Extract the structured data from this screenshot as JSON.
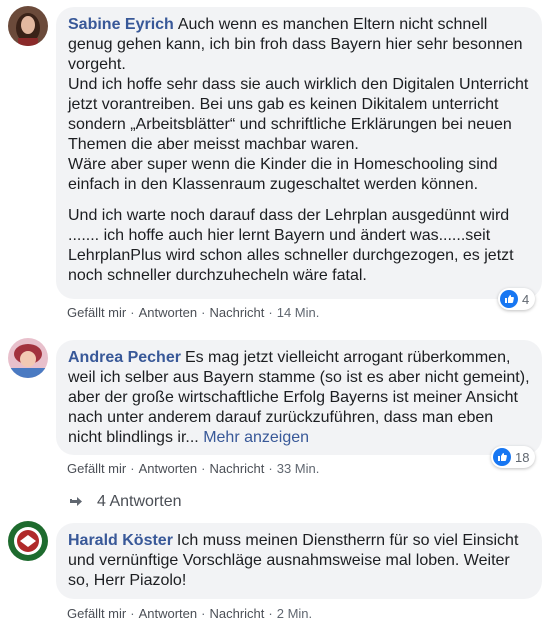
{
  "comments": [
    {
      "author": "Sabine Eyrich",
      "text_first": "Auch wenn es manchen Eltern nicht schnell genug gehen kann, ich bin froh dass Bayern hier sehr besonnen vorgeht.",
      "lines": [
        "Und ich hoffe sehr dass sie auch wirklich den Digitalen Unterricht jetzt vorantreiben. Bei uns gab es keinen Dikitalem unterricht sondern „Arbeitsblätter“ und schriftliche Erklärungen bei neuen Themen die aber meisst machbar waren.",
        "Wäre aber super wenn die Kinder die in Homeschooling sind einfach in den Klassenraum zugeschaltet werden können."
      ],
      "paragraph2": "Und ich warte noch darauf dass der Lehrplan ausgedünnt wird ....... ich hoffe auch hier lernt Bayern und ändert was......seit LehrplanPlus wird schon alles schneller durchgezogen, es jetzt noch schneller durchzuhecheln wäre fatal.",
      "reactions": "4",
      "like": "Gefällt mir",
      "reply": "Antworten",
      "message": "Nachricht",
      "time": "14 Min."
    },
    {
      "author": "Andrea Pecher",
      "text": "Es mag jetzt vielleicht arrogant rüberkommen, weil ich selber aus Bayern stamme (so ist es aber nicht gemeint), aber der große wirtschaftliche Erfolg Bayerns ist meiner Ansicht nach unter anderem darauf zurückzuführen, dass man eben nicht blindlings ir...",
      "more": "Mehr anzeigen",
      "reactions": "18",
      "like": "Gefällt mir",
      "reply": "Antworten",
      "message": "Nachricht",
      "time": "33 Min.",
      "replies_label": "4 Antworten"
    },
    {
      "author": "Harald Köster",
      "text": "Ich muss meinen Dienstherrn für so viel Einsicht und vernünftige Vorschläge ausnahmsweise mal loben. Weiter so, Herr Piazolo!",
      "like": "Gefällt mir",
      "reply": "Antworten",
      "message": "Nachricht",
      "time": "2 Min."
    }
  ],
  "colors": {
    "bubble": "#f2f3f5",
    "author": "#385898",
    "like_blue": "#1877f2",
    "meta": "#606770"
  },
  "icons": [
    "like-icon",
    "reply-arrow-icon"
  ]
}
